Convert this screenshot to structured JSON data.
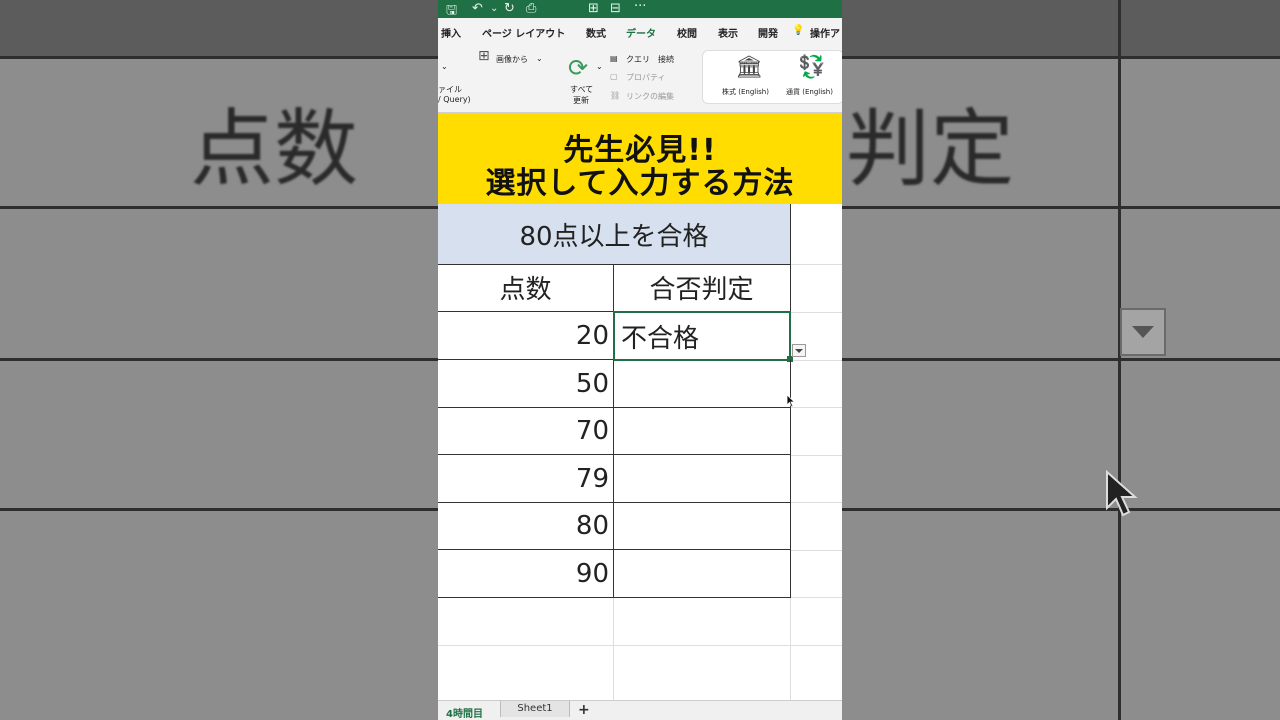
{
  "quick_access": [
    "🖫",
    "↶",
    "⌄",
    "↻",
    "⎙",
    "⊞",
    "⊟",
    "···"
  ],
  "ribbon_tabs": [
    "挿入",
    "ページ レイアウト",
    "数式",
    "データ",
    "校閲",
    "表示",
    "開発",
    "操作ア"
  ],
  "active_tab": "データ",
  "ribbon": {
    "from_file_top": "ァイル",
    "from_file_bottom": "/ Query)",
    "from_image": "画像から",
    "refresh_all_1": "すべて",
    "refresh_all_2": "更新",
    "queries_connections": "クエリ　接続",
    "properties": "プロパティ",
    "edit_links": "リンクの編集",
    "stocks": "株式 (English)",
    "currencies": "通貨 (English)"
  },
  "banner": {
    "line1": "先生必見!!",
    "line2": "選択して入力する方法"
  },
  "table": {
    "title": "80点以上を合格",
    "headers": [
      "点数",
      "合否判定"
    ],
    "rows": [
      {
        "score": "20",
        "result": "不合格"
      },
      {
        "score": "50",
        "result": ""
      },
      {
        "score": "70",
        "result": ""
      },
      {
        "score": "79",
        "result": ""
      },
      {
        "score": "80",
        "result": ""
      },
      {
        "score": "90",
        "result": ""
      }
    ]
  },
  "sheet_tabs": {
    "active": "4時間目",
    "other": "Sheet1",
    "add": "+"
  },
  "background_zoom": {
    "left_text": "点数",
    "right_text": "判定"
  },
  "colors": {
    "excel_green": "#1f7145",
    "banner_yellow": "#ffdd00",
    "title_cell_fill": "#d7e0ee"
  }
}
